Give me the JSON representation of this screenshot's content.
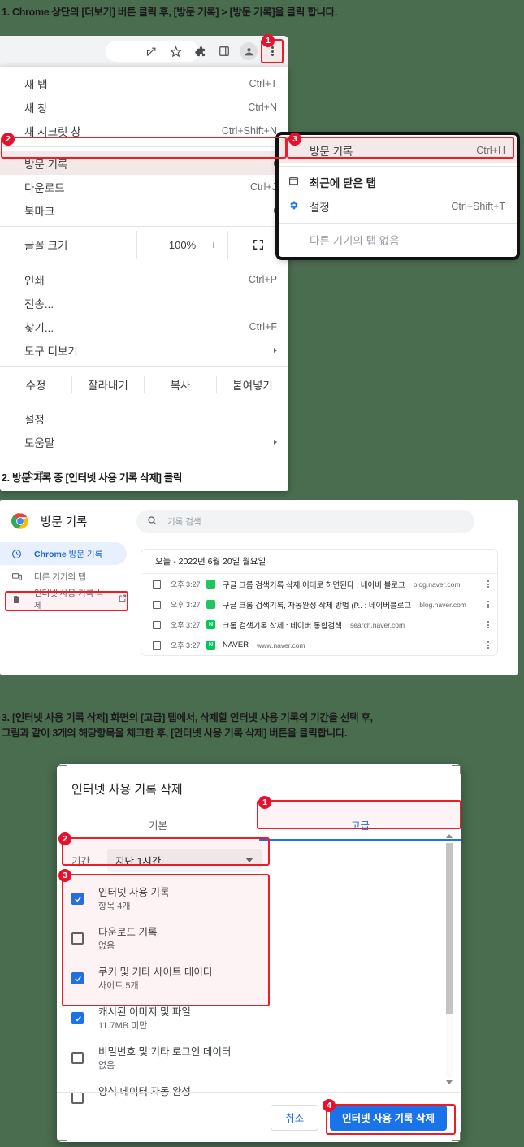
{
  "captions": {
    "step1": "1. Chrome 상단의 [더보기] 버튼 클릭 후, [방문 기록] > [방문 기록]을 클릭 합니다.",
    "step2": "2. 방문 기록 중 [인터넷 사용 기록 삭제] 클릭",
    "step3": "3. [인터넷 사용 기록 삭제] 화면의 [고급] 탭에서, 삭제할 인터넷 사용 기록의 기간을 선택 후,\n그림과 같이 3개의 해당항목을 체크한 후, [인터넷 사용 기록 삭제] 버튼을 클릭합니다."
  },
  "badges": {
    "b1": "1",
    "b2": "2",
    "b3": "3",
    "b4": "4"
  },
  "colors": {
    "annotation": "#ee1c25",
    "accent": "#1a73e8",
    "background": "#4a6d50"
  },
  "toolbar": {
    "icons": [
      "share-icon",
      "star-icon",
      "extensions-icon",
      "sidepanel-icon",
      "profile-icon",
      "kebab-menu-icon"
    ]
  },
  "chrome_menu": {
    "items": [
      {
        "label": "새 탭",
        "accel": "Ctrl+T",
        "arrow": false
      },
      {
        "label": "새 창",
        "accel": "Ctrl+N",
        "arrow": false
      },
      {
        "label": "새 시크릿 창",
        "accel": "Ctrl+Shift+N",
        "arrow": false
      },
      {
        "label": "방문 기록",
        "accel": "",
        "arrow": true,
        "highlight": true
      },
      {
        "label": "다운로드",
        "accel": "Ctrl+J",
        "arrow": false
      },
      {
        "label": "북마크",
        "accel": "",
        "arrow": true
      },
      {
        "label": "인쇄",
        "accel": "Ctrl+P",
        "arrow": false
      },
      {
        "label": "전송...",
        "accel": "",
        "arrow": false
      },
      {
        "label": "찾기...",
        "accel": "Ctrl+F",
        "arrow": false
      },
      {
        "label": "도구 더보기",
        "accel": "",
        "arrow": true
      },
      {
        "label": "설정",
        "accel": "",
        "arrow": false
      },
      {
        "label": "도움말",
        "accel": "",
        "arrow": true
      },
      {
        "label": "종료",
        "accel": "",
        "arrow": false
      }
    ],
    "zoom_row": {
      "label": "글꼴 크기",
      "minus": "−",
      "percent": "100%",
      "plus": "+",
      "fullscreen_icon": "fullscreen-icon"
    },
    "edit_row": {
      "label": "수정",
      "cut": "잘라내기",
      "copy": "복사",
      "paste": "붙여넣기"
    }
  },
  "history_submenu": {
    "items": [
      {
        "label": "방문 기록",
        "accel": "Ctrl+H",
        "icon": "",
        "bold": false,
        "highlight": true
      },
      {
        "label": "최근에 닫은 탭",
        "accel": "",
        "icon": "window-icon",
        "bold": true
      },
      {
        "label": "설정",
        "accel": "Ctrl+Shift+T",
        "icon": "gear-icon",
        "bold": false
      }
    ],
    "footer": "다른 기기의 탭 없음"
  },
  "history_page": {
    "title": "방문 기록",
    "search_placeholder": "기록 검색",
    "nav": [
      {
        "label_bold": "Chrome",
        "label_rest": " 방문 기록",
        "icon": "clock-icon",
        "active": true
      },
      {
        "label_bold": "",
        "label_rest": "다른 기기의 탭",
        "icon": "devices-icon",
        "active": false
      },
      {
        "label_bold": "",
        "label_rest": "인터넷 사용 기록 삭제",
        "icon": "trash-icon",
        "active": false,
        "external": true
      }
    ],
    "date_header": "오늘 - 2022년 6월 20일 월요일",
    "rows": [
      {
        "time": "오후 3:27",
        "title": "구글 크롬 검색기록 삭제 이대로 하면된다 : 네이버 블로그",
        "domain": "blog.naver.com",
        "favicon": "naver-blog"
      },
      {
        "time": "오후 3:27",
        "title": "구글 크롬 검색기록, 자동완성 삭제 방법 (P.. : 네이버블로그",
        "domain": "blog.naver.com",
        "favicon": "naver-blog"
      },
      {
        "time": "오후 3:27",
        "title": "크롬 검색기록 삭제 : 네이버 통합검색",
        "domain": "search.naver.com",
        "favicon": "naver"
      },
      {
        "time": "오후 3:27",
        "title": "NAVER",
        "domain": "www.naver.com",
        "favicon": "naver"
      }
    ]
  },
  "clear_dialog": {
    "title": "인터넷 사용 기록 삭제",
    "tabs": [
      {
        "label": "기본",
        "active": false
      },
      {
        "label": "고급",
        "active": true
      }
    ],
    "range_label": "기간",
    "range_value": "지난 1시간",
    "options": [
      {
        "title": "인터넷 사용 기록",
        "subtitle": "항목 4개",
        "checked": true
      },
      {
        "title": "다운로드 기록",
        "subtitle": "없음",
        "checked": false
      },
      {
        "title": "쿠키 및 기타 사이트 데이터",
        "subtitle": "사이트 5개",
        "checked": true
      },
      {
        "title": "캐시된 이미지 및 파일",
        "subtitle": "11.7MB 미만",
        "checked": true
      },
      {
        "title": "비밀번호 및 기타 로그인 데이터",
        "subtitle": "없음",
        "checked": false
      },
      {
        "title": "양식 데이터 자동 완성",
        "subtitle": "",
        "checked": false
      }
    ],
    "cancel_label": "취소",
    "confirm_label": "인터넷 사용 기록 삭제"
  }
}
